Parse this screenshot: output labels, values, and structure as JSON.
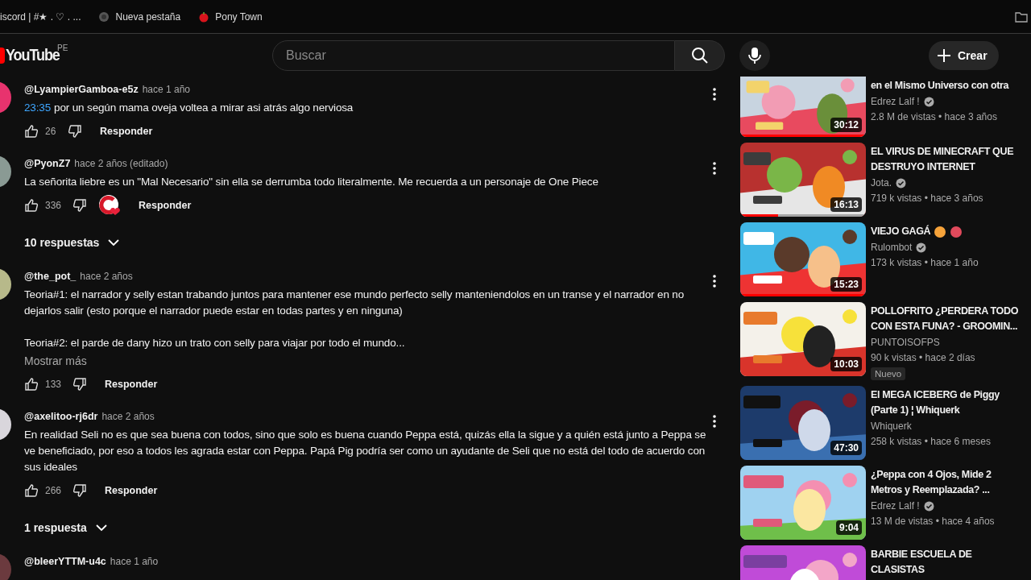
{
  "bookmarks": [
    {
      "label": "iscord | #★ . ♡ . ...",
      "kind": "none"
    },
    {
      "label": "Nueva pestaña",
      "kind": "globe"
    },
    {
      "label": "Pony Town",
      "kind": "apple"
    }
  ],
  "header": {
    "logo": "YouTube",
    "region": "PE",
    "search": {
      "placeholder": "Buscar"
    },
    "create": "Crear"
  },
  "comments": [
    {
      "author": "@LyampierGamboa-e5z",
      "time": "hace 1 año",
      "timestamp": "23:35",
      "text": "por un según mama oveja voltea a mirar asi atrás algo nerviosa",
      "likes": "26",
      "hearted": false,
      "reply": "Responder"
    },
    {
      "author": "@PyonZ7",
      "time": "hace 2 años (editado)",
      "text": "La señorita liebre es un \"Mal Necesario\" sin ella se derrumba todo literalmente. Me recuerda a un personaje de One Piece",
      "likes": "336",
      "hearted": true,
      "reply": "Responder",
      "replies": "10 respuestas"
    },
    {
      "author": "@the_pot_",
      "time": "hace 2 años",
      "text": "Teoria#1: el narrador y selly estan trabando juntos para mantener ese mundo perfecto selly manteniendolos en un transe y el narrador en no\ndejarlos salir (esto porque el narrador puede estar en todas partes y en ninguna)\n\nTeoria#2: el parde de dany hizo un trato con selly para viajar por todo el mundo...",
      "more": "Mostrar más",
      "likes": "133",
      "hearted": false,
      "reply": "Responder"
    },
    {
      "author": "@axelitoo-rj6dr",
      "time": "hace 2 años",
      "text": "En realidad Seli no es que sea buena con todos, sino que solo es buena cuando Peppa está, quizás ella la sigue y a quién está junto a Peppa se\nve beneficiado, por eso a todos les agrada estar con Peppa. Papá Pig podría ser como un ayudante de Seli que no está del todo de acuerdo con\nsus ideales",
      "likes": "266",
      "hearted": false,
      "reply": "Responder",
      "replies": "1 respuesta"
    },
    {
      "author": "@bleerYTTM-u4c",
      "time": "hace 1 año"
    }
  ],
  "videos": [
    {
      "title": "en el Mismo Universo con otra",
      "channel": "Edrez Lalf !",
      "verified": true,
      "meta": "2.8 M de vistas • hace 3 años",
      "duration": "30:12",
      "level": 1
    },
    {
      "title": "EL VIRUS DE MINECRAFT QUE\nDESTRUYO INTERNET",
      "channel": "Jota.",
      "verified": true,
      "meta": "719 k vistas • hace 3 años",
      "duration": "16:13",
      "level": 0.3
    },
    {
      "title": "VIEJO GAGÁ",
      "trailing_emoji": true,
      "channel": "Rulombot",
      "verified": true,
      "meta": "173 k vistas • hace 1 año",
      "duration": "15:23",
      "level": 1
    },
    {
      "title": "POLLOFRITO ¿PERDERA TODO\nCON ESTA FUNA? - GROOMIN...",
      "channel": "PUNTOISOFPS",
      "verified": false,
      "meta": "90 k vistas • hace 2 días",
      "badge": "Nuevo",
      "duration": "10:03"
    },
    {
      "title": "El MEGA ICEBERG de Piggy\n(Parte 1) ¦ Whiquerk",
      "channel": "Whiquerk",
      "verified": false,
      "meta": "258 k vistas • hace 6 meses",
      "duration": "47:30"
    },
    {
      "title": "¿Peppa con 4 Ojos, Mide 2\nMetros y Reemplazada? ...",
      "channel": "Edrez Lalf !",
      "verified": true,
      "meta": "13 M de vistas • hace 4 años",
      "duration": "9:04"
    },
    {
      "title": "BARBIE ESCUELA DE\nCLASISTAS"
    }
  ]
}
